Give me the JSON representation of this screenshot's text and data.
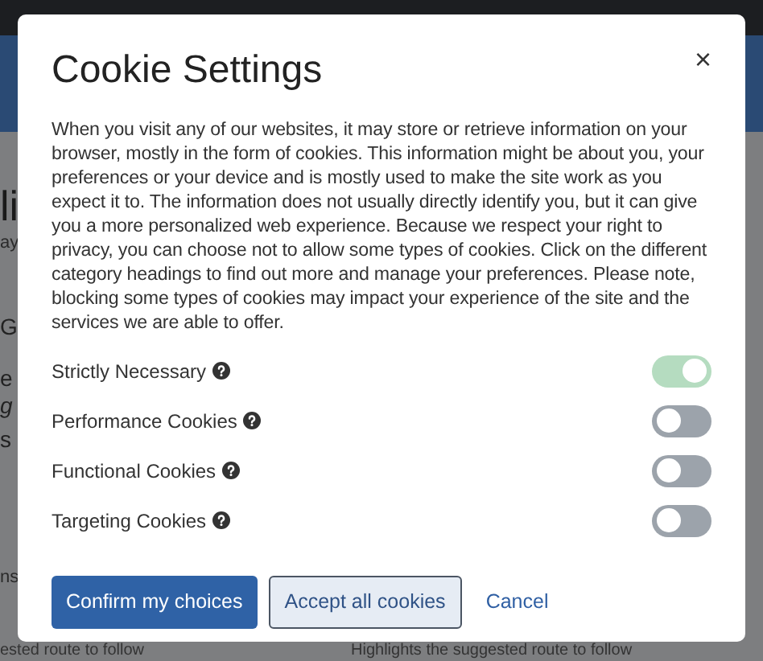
{
  "background": {
    "left_fragments": [
      {
        "text": "li",
        "kind": "heading"
      },
      {
        "text": "ay",
        "kind": "small"
      },
      {
        "text": "G",
        "kind": "label"
      },
      {
        "text": "e",
        "kind": "label"
      },
      {
        "text": "g",
        "kind": "italic"
      },
      {
        "text": "s",
        "kind": "label"
      },
      {
        "text": "ns",
        "kind": "small"
      }
    ],
    "footer_texts": [
      "ested route to follow",
      "Highlights the suggested route to follow"
    ]
  },
  "dialog": {
    "title": "Cookie Settings",
    "close": "×",
    "description": "When you visit any of our websites, it may store or retrieve information on your browser, mostly in the form of cookies. This information might be about you, your preferences or your device and is mostly used to make the site work as you expect it to. The information does not usually directly identify you, but it can give you a more personalized web experience. Because we respect your right to privacy, you can choose not to allow some types of cookies. Click on the different category headings to find out more and manage your preferences. Please note, blocking some types of cookies may impact your experience of the site and the services we are able to offer.",
    "categories": [
      {
        "label": "Strictly Necessary",
        "on": true,
        "disabled": true
      },
      {
        "label": "Performance Cookies",
        "on": false,
        "disabled": false
      },
      {
        "label": "Functional Cookies",
        "on": false,
        "disabled": false
      },
      {
        "label": "Targeting Cookies",
        "on": false,
        "disabled": false
      }
    ],
    "buttons": [
      {
        "label": "Confirm my choices",
        "kind": "primary"
      },
      {
        "label": "Accept all cookies",
        "kind": "secondary"
      },
      {
        "label": "Cancel",
        "kind": "link"
      }
    ]
  }
}
